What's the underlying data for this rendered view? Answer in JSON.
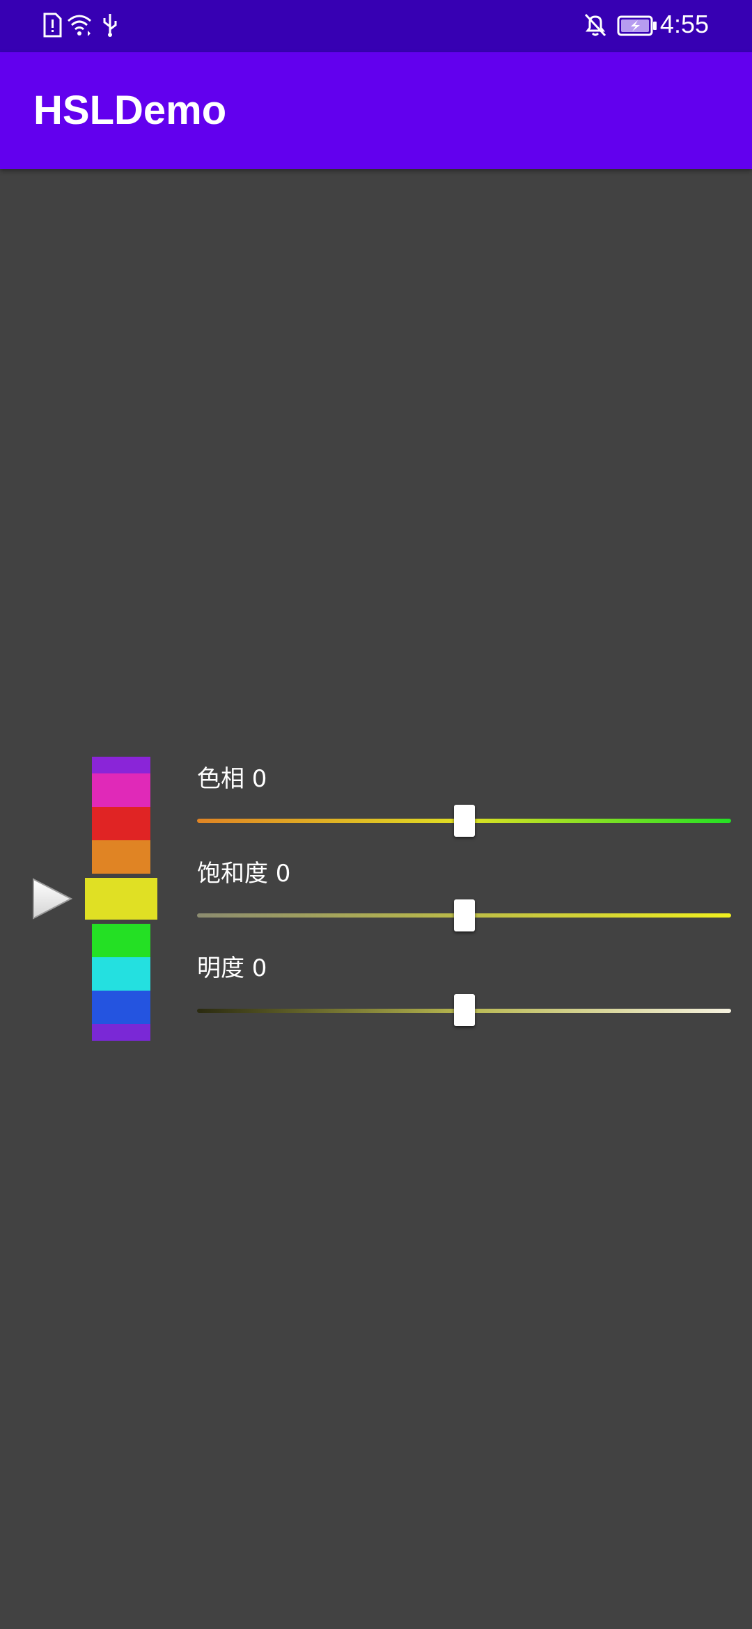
{
  "status_bar": {
    "time": "4:55",
    "icons": [
      "sim-alert-icon",
      "wifi-icon",
      "usb-icon",
      "notifications-off-icon",
      "battery-charging-icon"
    ]
  },
  "app_bar": {
    "title": "HSLDemo",
    "color": "#6200ee"
  },
  "colors": {
    "background": "#424242",
    "status_bar": "#3700b3"
  },
  "color_column": {
    "swatches": [
      {
        "name": "purple",
        "color": "#8a25d8",
        "selected": false
      },
      {
        "name": "magenta",
        "color": "#e029b8",
        "selected": false
      },
      {
        "name": "red",
        "color": "#e02424",
        "selected": false
      },
      {
        "name": "orange",
        "color": "#e08424",
        "selected": false
      },
      {
        "name": "yellow",
        "color": "#e0e024",
        "selected": true
      },
      {
        "name": "green",
        "color": "#24e024",
        "selected": false
      },
      {
        "name": "cyan",
        "color": "#24e0e0",
        "selected": false
      },
      {
        "name": "blue",
        "color": "#2454e0",
        "selected": false
      },
      {
        "name": "violet",
        "color": "#7a28d6",
        "selected": false
      }
    ]
  },
  "sliders": [
    {
      "label": "色相 0",
      "value": 0.5,
      "gradient": [
        "#e08424",
        "#e0e024",
        "#24e024"
      ]
    },
    {
      "label": "饱和度 0",
      "value": 0.5,
      "gradient": [
        "#8c8c70",
        "#bcbc48",
        "#f0f020"
      ]
    },
    {
      "label": "明度 0",
      "value": 0.5,
      "gradient": [
        "#2a2a10",
        "#b8b850",
        "#f6f2e0"
      ]
    }
  ]
}
